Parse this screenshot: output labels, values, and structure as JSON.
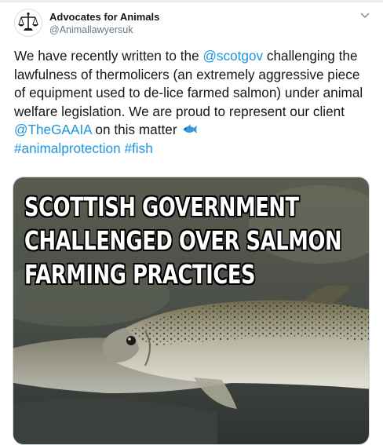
{
  "author": {
    "display_name": "Advocates for Animals",
    "handle": "@Animallawyersuk"
  },
  "tweet": {
    "text_1": "We have recently written to the ",
    "mention_1": "@scotgov",
    "text_2": " challenging the lawfulness of thermolicers (an extremely aggressive piece of equipment used to de-lice farmed salmon) under animal welfare legislation. We are proud to represent our client ",
    "mention_2": "@TheGAAIA",
    "text_3": " on this matter ",
    "emoji": "fish-emoji",
    "hashtag_1": "#animalprotection",
    "hashtag_2": "#fish"
  },
  "media": {
    "headline_line_1": "SCOTTISH GOVERNMENT",
    "headline_line_2": "CHALLENGED OVER SALMON",
    "headline_line_3": "FARMING PRACTICES"
  },
  "colors": {
    "link": "#1b95e0",
    "text": "#14171a",
    "secondary_text": "#657786"
  },
  "icons": [
    "scales-of-justice-avatar-icon",
    "chevron-down-icon",
    "fish-emoji-icon"
  ]
}
